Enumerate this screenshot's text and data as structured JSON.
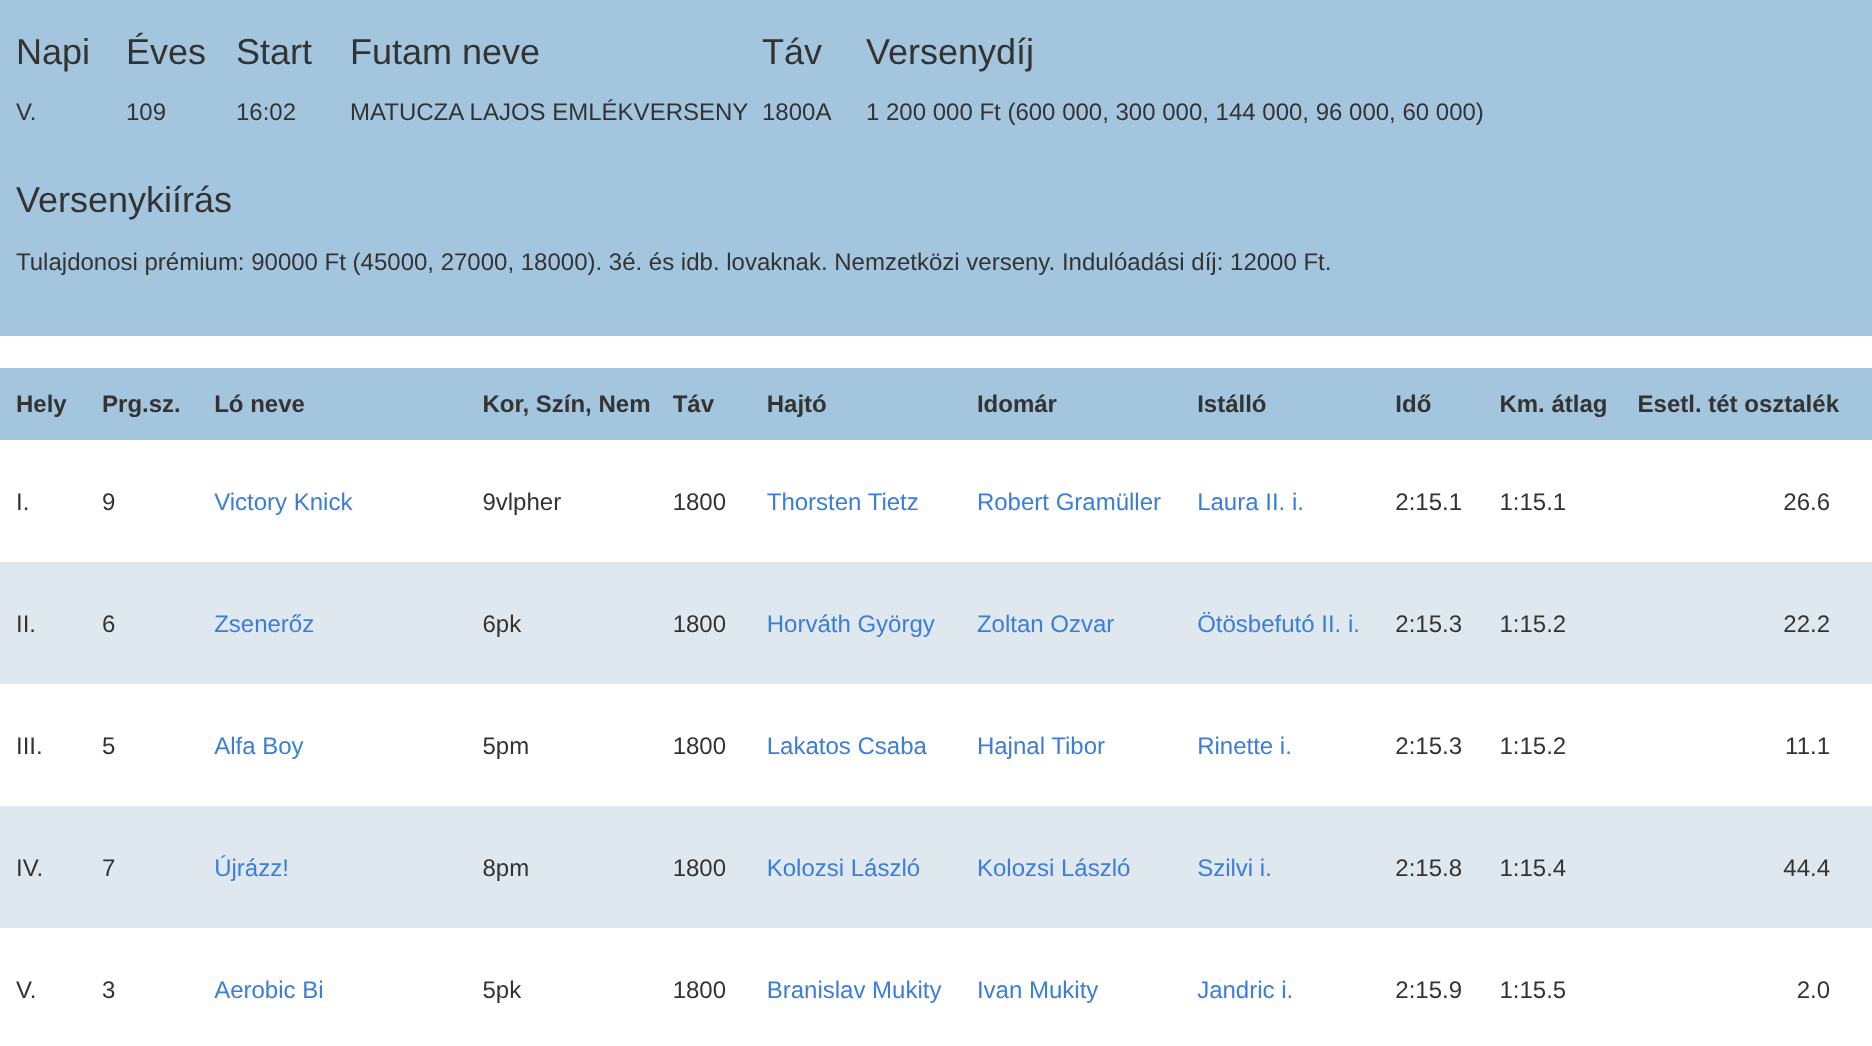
{
  "race": {
    "columns": [
      "Napi",
      "Éves",
      "Start",
      "Futam neve",
      "Táv",
      "Versenydíj"
    ],
    "values": [
      "V.",
      "109",
      "16:02",
      "MATUCZA LAJOS EMLÉKVERSENY",
      "1800A",
      "1 200 000 Ft (600 000, 300 000, 144 000, 96 000, 60 000)"
    ],
    "conditions_title": "Versenykiírás",
    "conditions": "Tulajdonosi prémium: 90000 Ft (45000, 27000, 18000). 3é. és idb. lovaknak. Nemzetközi verseny. Indulóadási díj: 12000 Ft."
  },
  "table": {
    "columns": [
      {
        "label": "Hely",
        "kind": "text"
      },
      {
        "label": "Prg.sz.",
        "kind": "text"
      },
      {
        "label": "Ló neve",
        "kind": "link"
      },
      {
        "label": "Kor, Szín, Nem",
        "kind": "text"
      },
      {
        "label": "Táv",
        "kind": "text"
      },
      {
        "label": "Hajtó",
        "kind": "link"
      },
      {
        "label": "Idomár",
        "kind": "link"
      },
      {
        "label": "Istálló",
        "kind": "link"
      },
      {
        "label": "Idő",
        "kind": "text"
      },
      {
        "label": "Km. átlag",
        "kind": "text"
      },
      {
        "label": "Esetl. tét osztalék",
        "kind": "number"
      }
    ],
    "rows": [
      [
        "I.",
        "9",
        "Victory Knick",
        "9vlpher",
        "1800",
        "Thorsten Tietz",
        "Robert Gramüller",
        "Laura II. i.",
        "2:15.1",
        "1:15.1",
        "26.6"
      ],
      [
        "II.",
        "6",
        "Zsenerőz",
        "6pk",
        "1800",
        "Horváth György",
        "Zoltan Ozvar",
        "Ötösbefutó II. i.",
        "2:15.3",
        "1:15.2",
        "22.2"
      ],
      [
        "III.",
        "5",
        "Alfa Boy",
        "5pm",
        "1800",
        "Lakatos Csaba",
        "Hajnal Tibor",
        "Rinette i.",
        "2:15.3",
        "1:15.2",
        "11.1"
      ],
      [
        "IV.",
        "7",
        "Újrázz!",
        "8pm",
        "1800",
        "Kolozsi László",
        "Kolozsi László",
        "Szilvi i.",
        "2:15.8",
        "1:15.4",
        "44.4"
      ],
      [
        "V.",
        "3",
        "Aerobic Bi",
        "5pk",
        "1800",
        "Branislav Mukity",
        "Ivan Mukity",
        "Jandric i.",
        "2:15.9",
        "1:15.5",
        "2.0"
      ]
    ]
  }
}
